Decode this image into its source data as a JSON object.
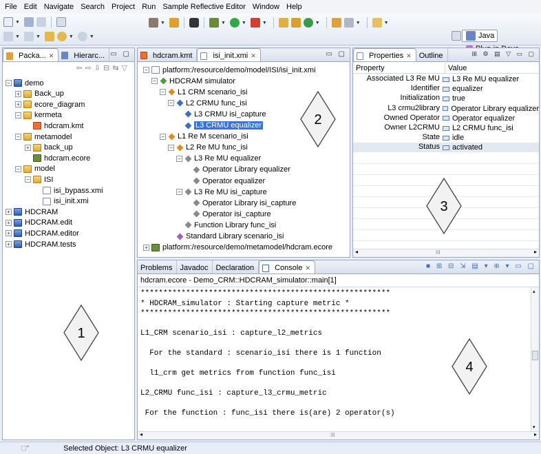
{
  "menu": [
    "File",
    "Edit",
    "Navigate",
    "Search",
    "Project",
    "Run",
    "Sample Reflective Editor",
    "Window",
    "Help"
  ],
  "perspective": {
    "java": "Java",
    "plugin": "Plug-in Deve..."
  },
  "left_pane": {
    "tabs": [
      "Packa...",
      "Hierarc..."
    ],
    "tree": [
      {
        "label": "demo",
        "icon": "project-icon",
        "exp": "-"
      },
      {
        "label": "Back_up",
        "icon": "folder-icon",
        "exp": "+"
      },
      {
        "label": "ecore_diagram",
        "icon": "folder-icon",
        "exp": "+"
      },
      {
        "label": "kermeta",
        "icon": "folder-icon",
        "exp": "-"
      },
      {
        "label": "hdcram.kmt",
        "icon": "kmt-file-icon",
        "exp": ""
      },
      {
        "label": "metamodel",
        "icon": "folder-icon",
        "exp": "-"
      },
      {
        "label": "back_up",
        "icon": "folder-icon",
        "exp": "+"
      },
      {
        "label": "hdcram.ecore",
        "icon": "ecore-file-icon",
        "exp": ""
      },
      {
        "label": "model",
        "icon": "folder-icon",
        "exp": "-"
      },
      {
        "label": "ISI",
        "icon": "folder-icon",
        "exp": "-"
      },
      {
        "label": "isi_bypass.xmi",
        "icon": "xmi-file-icon",
        "exp": ""
      },
      {
        "label": "isi_init.xmi",
        "icon": "xmi-file-icon",
        "exp": ""
      },
      {
        "label": "HDCRAM",
        "icon": "project-icon",
        "exp": "+"
      },
      {
        "label": "HDCRAM.edit",
        "icon": "project-icon",
        "exp": "+"
      },
      {
        "label": "HDCRAM.editor",
        "icon": "project-icon",
        "exp": "+"
      },
      {
        "label": "HDCRAM.tests",
        "icon": "project-icon",
        "exp": "+"
      }
    ]
  },
  "editor": {
    "tabs": [
      "hdcram.kmt",
      "isi_init.xmi"
    ],
    "tree": [
      {
        "label": "platform:/resource/demo/model/ISI/isi_init.xmi",
        "exp": "-"
      },
      {
        "label": "HDCRAM simulator",
        "exp": "-"
      },
      {
        "label": "L1 CRM scenario_isi",
        "exp": "-"
      },
      {
        "label": "L2 CRMU func_isi",
        "exp": "-"
      },
      {
        "label": "L3 CRMU isi_capture",
        "exp": ""
      },
      {
        "label": "L3 CRMU equalizer",
        "exp": ""
      },
      {
        "label": "L1 Re M scenario_isi",
        "exp": "-"
      },
      {
        "label": "L2 Re MU func_isi",
        "exp": "-"
      },
      {
        "label": "L3 Re MU equalizer",
        "exp": "-"
      },
      {
        "label": "Operator Library equalizer",
        "exp": ""
      },
      {
        "label": "Operator equalizer",
        "exp": ""
      },
      {
        "label": "L3 Re MU isi_capture",
        "exp": "-"
      },
      {
        "label": "Operator Library isi_capture",
        "exp": ""
      },
      {
        "label": "Operator isi_capture",
        "exp": ""
      },
      {
        "label": "Function Library func_isi",
        "exp": ""
      },
      {
        "label": "Standard Library scenario_isi",
        "exp": ""
      },
      {
        "label": "platform:/resource/demo/metamodel/hdcram.ecore",
        "exp": "+"
      }
    ]
  },
  "properties": {
    "tabs": [
      "Properties",
      "Outline"
    ],
    "header": {
      "property": "Property",
      "value": "Value"
    },
    "rows": [
      {
        "k": "Associated L3 Re MU",
        "v": "L3 Re MU equalizer"
      },
      {
        "k": "Identifier",
        "v": "equalizer"
      },
      {
        "k": "Initialization",
        "v": "true"
      },
      {
        "k": "L3 crmu2library",
        "v": "Operator Library equalizer"
      },
      {
        "k": "Owned Operator",
        "v": "Operator equalizer"
      },
      {
        "k": "Owner L2CRMU",
        "v": "L2 CRMU func_isi"
      },
      {
        "k": "State",
        "v": "idle"
      },
      {
        "k": "Status",
        "v": "activated"
      }
    ]
  },
  "console": {
    "tabs": [
      "Problems",
      "Javadoc",
      "Declaration",
      "Console"
    ],
    "title": "hdcram.ecore - Demo_CRM::HDCRAM_simulator::main[1]",
    "lines": [
      "*******************************************************",
      "* HDCRAM_simulator : Starting capture metric *",
      "*******************************************************",
      "",
      "L1_CRM scenario_isi : capture_l2_metrics",
      "",
      "  For the standard : scenario_isi there is 1 function",
      "",
      "  l1_crm get metrics from function func_isi",
      "",
      "L2_CRMU func_isi : capture_l3_crmu_metric",
      "",
      " For the function : func_isi there is(are) 2 operator(s)"
    ]
  },
  "callouts": [
    "1",
    "2",
    "3",
    "4"
  ],
  "status": {
    "text": "Selected Object: L3 CRMU equalizer"
  },
  "scroll_glyph": "III"
}
